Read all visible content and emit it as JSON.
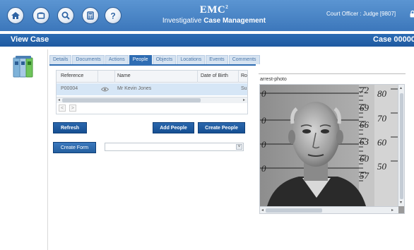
{
  "header": {
    "brand": "EMC",
    "brand_sup": "2",
    "subtitle_plain": "Investigative ",
    "subtitle_bold": "Case Management",
    "user": "Court Officer : Judge [9807]",
    "nav_icons": [
      "home-icon",
      "eject-icon",
      "search-icon",
      "calculator-icon",
      "help-icon"
    ]
  },
  "titlebar": {
    "title": "View Case",
    "case_label": "Case 00000"
  },
  "tabs": [
    "Details",
    "Documents",
    "Actions",
    "People",
    "Objects",
    "Locations",
    "Events",
    "Comments"
  ],
  "active_tab": "People",
  "table": {
    "headers": [
      "Reference",
      "",
      "Name",
      "Date of Birth",
      "Ro"
    ],
    "rows": [
      {
        "reference": "P00004",
        "name": "Mr Kevin Jones",
        "dob": "",
        "role": "Su"
      }
    ],
    "pager": [
      "<",
      ">"
    ]
  },
  "buttons": {
    "refresh": "Refresh",
    "add_people": "Add People",
    "create_people": "Create People",
    "create_form": "Create Form"
  },
  "form_select": {
    "value": ""
  },
  "photo": {
    "label": "arrest-photo",
    "ruler_left": [
      "0",
      "0",
      "0",
      "0"
    ],
    "ruler_mid": [
      "72",
      "69",
      "66",
      "63",
      "60",
      "57"
    ],
    "ruler_right": [
      "80",
      "70",
      "60",
      "50"
    ]
  },
  "colors": {
    "header": "#3c77bb",
    "titlebar": "#1f5aa0",
    "button": "#164f92",
    "active_tab": "#2f6db3",
    "selected_row": "#d6e6f6"
  }
}
